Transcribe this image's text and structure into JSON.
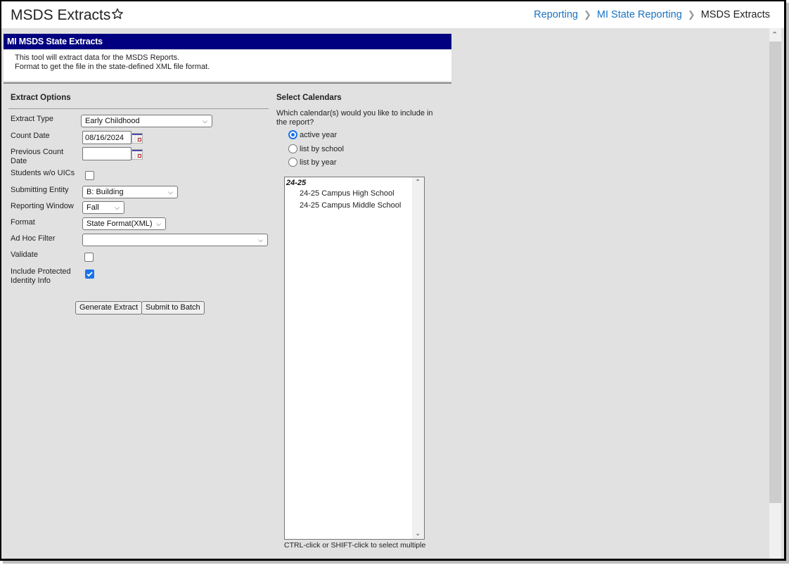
{
  "header": {
    "title": "MSDS Extracts",
    "favorite_icon": "star-outline-icon",
    "breadcrumb": [
      {
        "label": "Reporting",
        "link": true
      },
      {
        "label": "MI State Reporting",
        "link": true
      },
      {
        "label": "MSDS Extracts",
        "link": false
      }
    ]
  },
  "panel": {
    "title": "MI MSDS State Extracts",
    "description_line1": "This tool will extract data for the MSDS Reports.",
    "description_line2": "Format to get the file in the state-defined XML file format."
  },
  "extract_options": {
    "title": "Extract Options",
    "fields": {
      "extract_type": {
        "label": "Extract Type",
        "value": "Early Childhood"
      },
      "count_date": {
        "label": "Count Date",
        "value": "08/16/2024"
      },
      "previous_count_date": {
        "label": "Previous Count Date",
        "label_line1": "Previous Count",
        "label_line2": "Date",
        "value": ""
      },
      "students_without_uics": {
        "label": "Students w/o UICs",
        "checked": false
      },
      "submitting_entity": {
        "label": "Submitting Entity",
        "value": "B: Building"
      },
      "reporting_window": {
        "label": "Reporting Window",
        "value": "Fall"
      },
      "format": {
        "label": "Format",
        "value": "State Format(XML)"
      },
      "ad_hoc_filter": {
        "label": "Ad Hoc Filter",
        "value": ""
      },
      "validate": {
        "label": "Validate",
        "checked": false
      },
      "include_protected_identity_info": {
        "label": "Include Protected Identity Info",
        "label_line1": "Include Protected",
        "label_line2": "Identity Info",
        "checked": true
      }
    },
    "buttons": {
      "generate": "Generate Extract",
      "submit_batch": "Submit to Batch"
    }
  },
  "select_calendars": {
    "title": "Select Calendars",
    "question_line1": "Which calendar(s) would you like to include in",
    "question_line2": "the report?",
    "options": [
      {
        "label": "active year",
        "selected": true
      },
      {
        "label": "list by school",
        "selected": false
      },
      {
        "label": "list by year",
        "selected": false
      }
    ],
    "list": {
      "group": "24-25",
      "items": [
        "24-25 Campus High School",
        "24-25 Campus Middle School"
      ]
    },
    "hint": "CTRL-click or SHIFT-click to select multiple"
  }
}
